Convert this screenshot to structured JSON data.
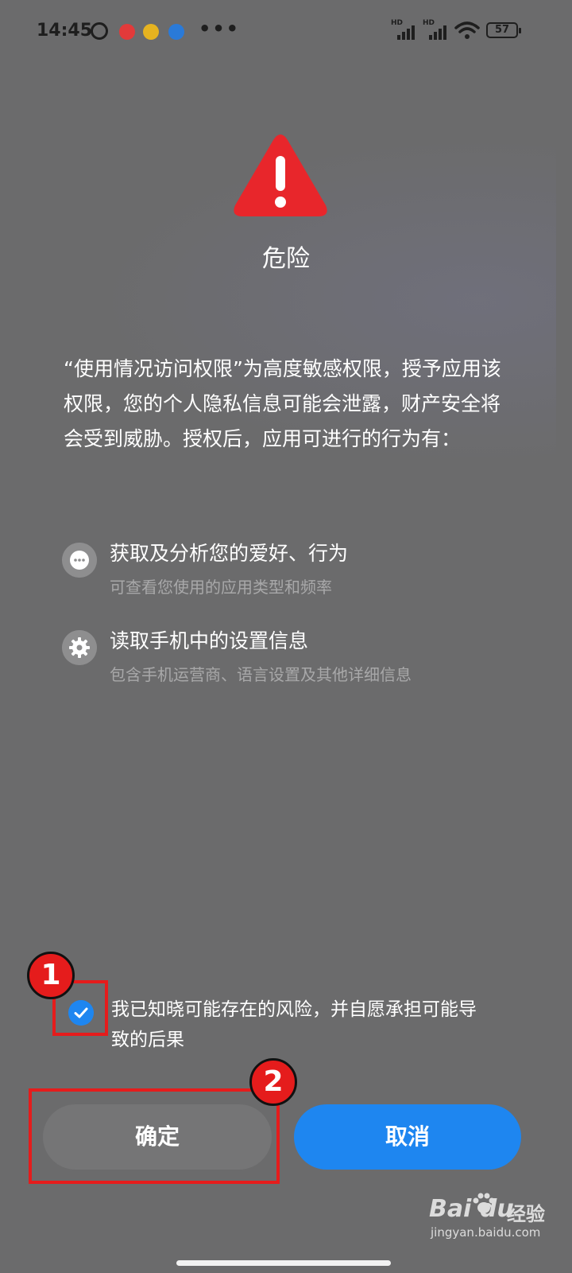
{
  "status_bar": {
    "time": "14:45",
    "battery": "57",
    "hd1": "HD",
    "hd2": "HD",
    "icons": [
      "alarm-icon",
      "app-icon-red",
      "app-icon-yellow",
      "app-icon-blue",
      "more-dots-icon",
      "signal-icon",
      "signal-icon",
      "wifi-icon",
      "battery-icon"
    ]
  },
  "dialog": {
    "title": "危险",
    "description": "“使用情况访问权限”为高度敏感权限，授予应用该权限，您的个人隐私信息可能会泄露，财产安全将会受到威胁。授权后，应用可进行的行为有：",
    "items": [
      {
        "icon": "chat-bubble-icon",
        "title": "获取及分析您的爱好、行为",
        "subtitle": "可查看您使用的应用类型和频率"
      },
      {
        "icon": "gear-icon",
        "title": "读取手机中的设置信息",
        "subtitle": "包含手机运营商、语言设置及其他详细信息"
      }
    ],
    "checkbox": {
      "checked": true,
      "label": "我已知晓可能存在的风险，并自愿承担可能导致的后果"
    },
    "buttons": {
      "confirm": "确定",
      "cancel": "取消"
    }
  },
  "annotations": {
    "badge1": "1",
    "badge2": "2"
  },
  "watermark": {
    "logo": "Bai  du",
    "cn": "经验",
    "url": "jingyan.baidu.com"
  },
  "colors": {
    "overlay": "#6b6b6c",
    "accent_blue": "#1e86f0",
    "warning_red": "#e8262b",
    "annotation_red": "#e51c1c"
  }
}
